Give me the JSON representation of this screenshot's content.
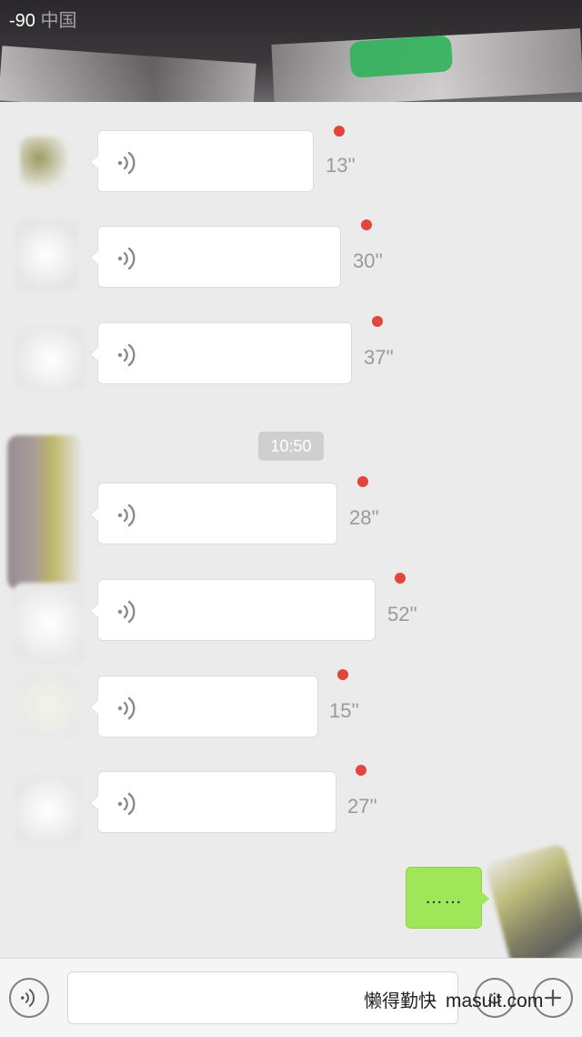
{
  "status_bar": {
    "signal": "-90",
    "carrier": "中国"
  },
  "messages": [
    {
      "duration": "13''",
      "unread": true
    },
    {
      "duration": "30''",
      "unread": true
    },
    {
      "duration": "37''",
      "unread": true
    },
    {
      "duration": "28''",
      "unread": true
    },
    {
      "duration": "52''",
      "unread": true
    },
    {
      "duration": "15''",
      "unread": true
    },
    {
      "duration": "27''",
      "unread": true
    }
  ],
  "timestamp": "10:50",
  "sent_message": {
    "text": "……"
  },
  "input_bar": {
    "text_value": ""
  },
  "watermark": {
    "text": "懒得勤快",
    "domain": "masuit.com"
  },
  "colors": {
    "background": "#ebebeb",
    "unread_dot": "#e2453c",
    "sent_bubble": "#9fe658"
  },
  "icons": [
    "voice-icon",
    "emoji-icon",
    "plus-icon"
  ]
}
